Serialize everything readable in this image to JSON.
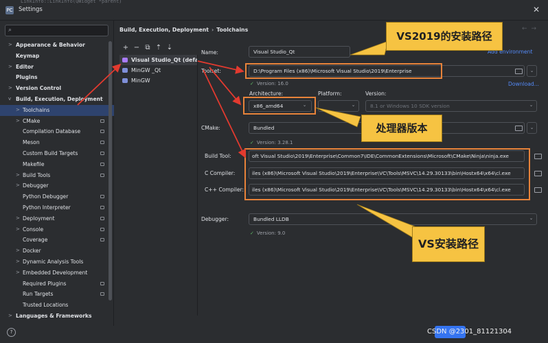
{
  "window": {
    "title": "Settings",
    "editor_peek": "LinkInfo::LinkInfo(QWidget *parent)",
    "app_icon": "pycharm-logo-icon",
    "close_glyph": "✕"
  },
  "search": {
    "placeholder": "",
    "icon": "search-icon"
  },
  "sidebar": {
    "items": [
      {
        "label": "Appearance & Behavior",
        "bold": true,
        "chevron": ">"
      },
      {
        "label": "Keymap",
        "bold": true
      },
      {
        "label": "Editor",
        "bold": true,
        "chevron": ">"
      },
      {
        "label": "Plugins",
        "bold": true
      },
      {
        "label": "Version Control",
        "bold": true,
        "chevron": ">"
      },
      {
        "label": "Build, Execution, Deployment",
        "bold": true,
        "chevron": "v"
      },
      {
        "label": "Toolchains",
        "sub": true,
        "chevron": ">",
        "selected": true
      },
      {
        "label": "CMake",
        "sub": true,
        "chevron": ">",
        "lock": true
      },
      {
        "label": "Compilation Database",
        "sub": true,
        "lock": true
      },
      {
        "label": "Meson",
        "sub": true,
        "lock": true
      },
      {
        "label": "Custom Build Targets",
        "sub": true,
        "lock": true
      },
      {
        "label": "Makefile",
        "sub": true,
        "lock": true
      },
      {
        "label": "Build Tools",
        "sub": true,
        "chevron": ">",
        "lock": true
      },
      {
        "label": "Debugger",
        "sub": true,
        "chevron": ">"
      },
      {
        "label": "Python Debugger",
        "sub": true,
        "lock": true
      },
      {
        "label": "Python Interpreter",
        "sub": true,
        "lock": true
      },
      {
        "label": "Deployment",
        "sub": true,
        "chevron": ">",
        "lock": true
      },
      {
        "label": "Console",
        "sub": true,
        "chevron": ">",
        "lock": true
      },
      {
        "label": "Coverage",
        "sub": true,
        "lock": true
      },
      {
        "label": "Docker",
        "sub": true,
        "chevron": ">"
      },
      {
        "label": "Dynamic Analysis Tools",
        "sub": true,
        "chevron": ">"
      },
      {
        "label": "Embedded Development",
        "sub": true,
        "chevron": ">"
      },
      {
        "label": "Required Plugins",
        "sub": true,
        "lock": true
      },
      {
        "label": "Run Targets",
        "sub": true,
        "lock": true
      },
      {
        "label": "Trusted Locations",
        "sub": true
      },
      {
        "label": "Languages & Frameworks",
        "bold": true,
        "chevron": ">"
      }
    ]
  },
  "help_label": "?",
  "breadcrumb": {
    "parent": "Build, Execution, Deployment",
    "separator": "›",
    "current": "Toolchains"
  },
  "nav": {
    "back": "←",
    "forward": "→"
  },
  "toolchain_toolbar": {
    "add": "+",
    "remove": "−",
    "copy": "⧉",
    "up": "⇡",
    "down": "⇣"
  },
  "toolchains": [
    {
      "name": "Visual Studio_Qt (default)",
      "selected": true,
      "icon": "visual-studio-icon",
      "color": "#a97bff"
    },
    {
      "name": "MinGW _Qt",
      "icon": "mingw-icon",
      "color": "#7f8fd9"
    },
    {
      "name": "MinGW",
      "icon": "mingw-icon",
      "color": "#7f8fd9"
    }
  ],
  "form": {
    "name_label": "Name:",
    "name_value": "Visual Studio_Qt",
    "add_env_link": "Add environment",
    "toolset_label": "Toolset:",
    "toolset_value": "D:\\Program Files (x86)\\Microsoft Visual Studio\\2019\\Enterprise",
    "toolset_version": "Version: 16.0",
    "download_link": "Download...",
    "architecture_label": "Architecture:",
    "architecture_value": "x86_amd64",
    "platform_label": "Platform:",
    "platform_value": "",
    "version_label": "Version:",
    "version_value": "8.1 or Windows 10 SDK version",
    "cmake_label": "CMake:",
    "cmake_value": "Bundled",
    "cmake_version": "Version: 3.28.1",
    "build_tool_label": "Build Tool:",
    "build_tool_value": "oft Visual Studio\\2019\\Enterprise\\Common7\\IDE\\CommonExtensions\\Microsoft\\CMake\\Ninja\\ninja.exe",
    "c_compiler_label": "C Compiler:",
    "c_compiler_value": "iles (x86)\\Microsoft Visual Studio\\2019\\Enterprise\\VC\\Tools\\MSVC\\14.29.30133\\bin\\Hostx64\\x64\\cl.exe",
    "cpp_compiler_label": "C++ Compiler:",
    "cpp_compiler_value": "iles (x86)\\Microsoft Visual Studio\\2019\\Enterprise\\VC\\Tools\\MSVC\\14.29.30133\\bin\\Hostx64\\x64\\cl.exe",
    "debugger_label": "Debugger:",
    "debugger_value": "Bundled LLDB",
    "debugger_version": "Version: 9.0",
    "check_glyph": "✓",
    "dropdown_glyph": "⌄"
  },
  "annotations": {
    "callout1": "VS2019的安装路径",
    "callout2": "处理器版本",
    "callout3": "VS安装路径",
    "box_color": "#e8833a",
    "callout_color": "#f6c342",
    "arrow_color": "#e23a2f"
  },
  "footer": {
    "ok_label": "",
    "watermark": "CSDN @2301_81121304"
  },
  "colors": {
    "background": "#2b2d30",
    "selection": "#2e436e",
    "accent": "#3574f0",
    "link": "#548af7",
    "ok_green": "#5fb865"
  }
}
